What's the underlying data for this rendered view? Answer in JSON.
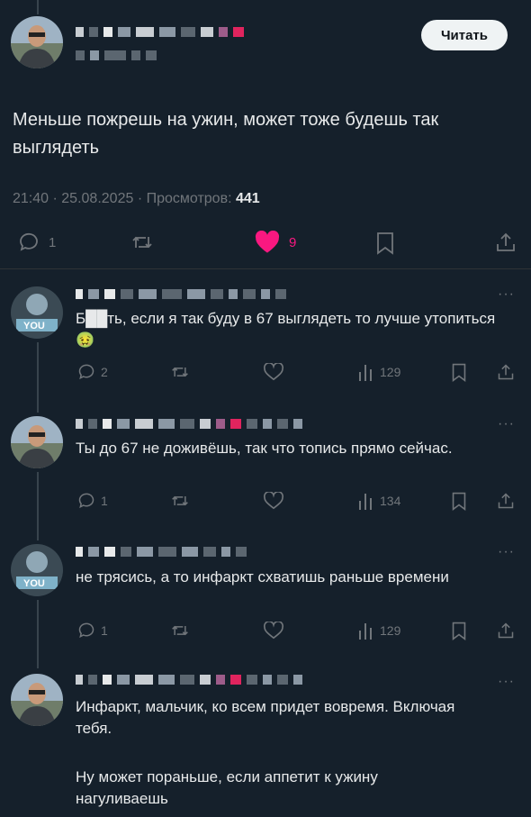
{
  "post": {
    "read_button": "Читать",
    "text": "Меньше пожрешь на ужин, может тоже будешь так выглядеть",
    "time": "21:40",
    "date": "25.08.2025",
    "views_label": "Просмотров:",
    "views_count": "441",
    "sep": "·",
    "replies": "1",
    "likes": "9"
  },
  "replies": [
    {
      "text": "Б██ть, если я так буду в 67 выглядеть то лучше утопиться🤢",
      "reply_count": "2",
      "views": "129"
    },
    {
      "text": "Ты до 67 не доживёшь, так что топись прямо сейчас.",
      "reply_count": "1",
      "views": "134"
    },
    {
      "text": "не трясись, а то инфаркт схватишь раньше времени",
      "reply_count": "1",
      "views": "129"
    },
    {
      "text": "Инфаркт, мальчик, ко всем придет вовремя. Включая тебя.",
      "text2": "Ну может пораньше, если аппетит к ужину нагуливаешь"
    }
  ],
  "more_glyph": "···",
  "colors": {
    "background": "#15202b",
    "like_active": "#f91880",
    "muted": "#71767b",
    "text": "#e7e9ea"
  },
  "icons": [
    "reply-icon",
    "retweet-icon",
    "heart-icon",
    "bookmark-icon",
    "share-icon",
    "views-icon",
    "more-icon"
  ]
}
